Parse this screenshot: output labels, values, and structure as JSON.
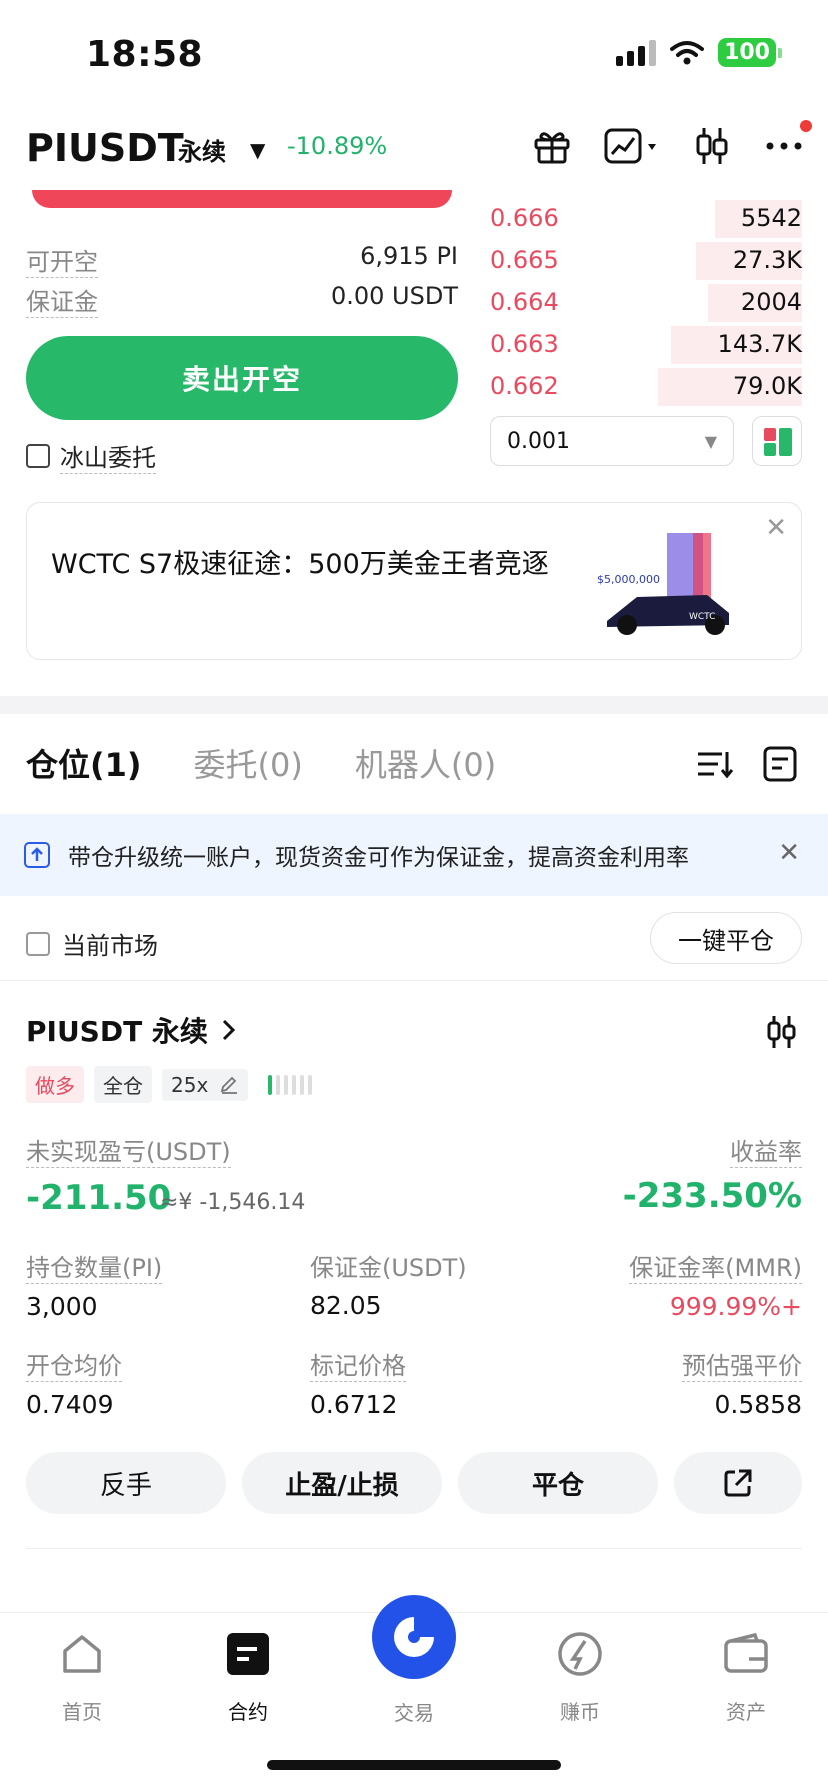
{
  "status_bar": {
    "time": "18:58",
    "battery": "100"
  },
  "header": {
    "pair": "PIUSDT",
    "contract_type": "永续",
    "change": "-10.89%"
  },
  "order_panel": {
    "available_short_label": "可开空",
    "available_short_value": "6,915 PI",
    "margin_label": "保证金",
    "margin_value": "0.00 USDT",
    "sell_button": "卖出开空",
    "iceberg_label": "冰山委托"
  },
  "orderbook": {
    "asks": [
      {
        "price": "0.666",
        "qty": "5542",
        "depth": 0.28
      },
      {
        "price": "0.665",
        "qty": "27.3K",
        "depth": 0.34
      },
      {
        "price": "0.664",
        "qty": "2004",
        "depth": 0.3
      },
      {
        "price": "0.663",
        "qty": "143.7K",
        "depth": 0.42
      },
      {
        "price": "0.662",
        "qty": "79.0K",
        "depth": 0.46
      }
    ],
    "precision": "0.001"
  },
  "banner": {
    "text": "WCTC S7极速征途：500万美金王者竞逐",
    "image_caption": "$5,000,000",
    "image_logo": "WCTC"
  },
  "tabs": [
    "仓位(1)",
    "委托(0)",
    "机器人(0)"
  ],
  "notice": "带仓升级统一账户，现货资金可作为保证金，提高资金利用率",
  "filter": {
    "current_market": "当前市场",
    "close_all": "一键平仓"
  },
  "position": {
    "title": "PIUSDT 永续",
    "side": "做多",
    "margin_mode": "全仓",
    "leverage": "25x",
    "leverage_bars_on": 1,
    "pnl_label": "未实现盈亏(USDT)",
    "pnl_value": "-211.50",
    "pnl_cny": "≈¥ -1,546.14",
    "roe_label": "收益率",
    "roe_value": "-233.50%",
    "size_label": "持仓数量(PI)",
    "size_value": "3,000",
    "margin_label": "保证金(USDT)",
    "margin_value": "82.05",
    "mmr_label": "保证金率(MMR)",
    "mmr_value": "999.99%+",
    "entry_label": "开仓均价",
    "entry_value": "0.7409",
    "mark_label": "标记价格",
    "mark_value": "0.6712",
    "liq_label": "预估强平价",
    "liq_value": "0.5858",
    "actions": [
      "反手",
      "止盈/止损",
      "平仓"
    ]
  },
  "bottom_nav": {
    "items": [
      "首页",
      "合约",
      "交易",
      "赚币",
      "资产"
    ],
    "active": "合约"
  },
  "colors": {
    "green": "#27b86a",
    "red": "#e84a5f",
    "blue": "#2352e8"
  }
}
